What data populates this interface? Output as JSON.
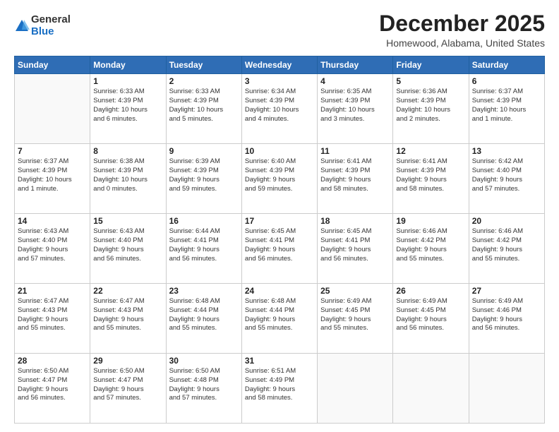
{
  "logo": {
    "general": "General",
    "blue": "Blue"
  },
  "title": "December 2025",
  "location": "Homewood, Alabama, United States",
  "weekdays": [
    "Sunday",
    "Monday",
    "Tuesday",
    "Wednesday",
    "Thursday",
    "Friday",
    "Saturday"
  ],
  "weeks": [
    [
      {
        "day": "",
        "info": ""
      },
      {
        "day": "1",
        "info": "Sunrise: 6:33 AM\nSunset: 4:39 PM\nDaylight: 10 hours\nand 6 minutes."
      },
      {
        "day": "2",
        "info": "Sunrise: 6:33 AM\nSunset: 4:39 PM\nDaylight: 10 hours\nand 5 minutes."
      },
      {
        "day": "3",
        "info": "Sunrise: 6:34 AM\nSunset: 4:39 PM\nDaylight: 10 hours\nand 4 minutes."
      },
      {
        "day": "4",
        "info": "Sunrise: 6:35 AM\nSunset: 4:39 PM\nDaylight: 10 hours\nand 3 minutes."
      },
      {
        "day": "5",
        "info": "Sunrise: 6:36 AM\nSunset: 4:39 PM\nDaylight: 10 hours\nand 2 minutes."
      },
      {
        "day": "6",
        "info": "Sunrise: 6:37 AM\nSunset: 4:39 PM\nDaylight: 10 hours\nand 1 minute."
      }
    ],
    [
      {
        "day": "7",
        "info": "Sunrise: 6:37 AM\nSunset: 4:39 PM\nDaylight: 10 hours\nand 1 minute."
      },
      {
        "day": "8",
        "info": "Sunrise: 6:38 AM\nSunset: 4:39 PM\nDaylight: 10 hours\nand 0 minutes."
      },
      {
        "day": "9",
        "info": "Sunrise: 6:39 AM\nSunset: 4:39 PM\nDaylight: 9 hours\nand 59 minutes."
      },
      {
        "day": "10",
        "info": "Sunrise: 6:40 AM\nSunset: 4:39 PM\nDaylight: 9 hours\nand 59 minutes."
      },
      {
        "day": "11",
        "info": "Sunrise: 6:41 AM\nSunset: 4:39 PM\nDaylight: 9 hours\nand 58 minutes."
      },
      {
        "day": "12",
        "info": "Sunrise: 6:41 AM\nSunset: 4:39 PM\nDaylight: 9 hours\nand 58 minutes."
      },
      {
        "day": "13",
        "info": "Sunrise: 6:42 AM\nSunset: 4:40 PM\nDaylight: 9 hours\nand 57 minutes."
      }
    ],
    [
      {
        "day": "14",
        "info": "Sunrise: 6:43 AM\nSunset: 4:40 PM\nDaylight: 9 hours\nand 57 minutes."
      },
      {
        "day": "15",
        "info": "Sunrise: 6:43 AM\nSunset: 4:40 PM\nDaylight: 9 hours\nand 56 minutes."
      },
      {
        "day": "16",
        "info": "Sunrise: 6:44 AM\nSunset: 4:41 PM\nDaylight: 9 hours\nand 56 minutes."
      },
      {
        "day": "17",
        "info": "Sunrise: 6:45 AM\nSunset: 4:41 PM\nDaylight: 9 hours\nand 56 minutes."
      },
      {
        "day": "18",
        "info": "Sunrise: 6:45 AM\nSunset: 4:41 PM\nDaylight: 9 hours\nand 56 minutes."
      },
      {
        "day": "19",
        "info": "Sunrise: 6:46 AM\nSunset: 4:42 PM\nDaylight: 9 hours\nand 55 minutes."
      },
      {
        "day": "20",
        "info": "Sunrise: 6:46 AM\nSunset: 4:42 PM\nDaylight: 9 hours\nand 55 minutes."
      }
    ],
    [
      {
        "day": "21",
        "info": "Sunrise: 6:47 AM\nSunset: 4:43 PM\nDaylight: 9 hours\nand 55 minutes."
      },
      {
        "day": "22",
        "info": "Sunrise: 6:47 AM\nSunset: 4:43 PM\nDaylight: 9 hours\nand 55 minutes."
      },
      {
        "day": "23",
        "info": "Sunrise: 6:48 AM\nSunset: 4:44 PM\nDaylight: 9 hours\nand 55 minutes."
      },
      {
        "day": "24",
        "info": "Sunrise: 6:48 AM\nSunset: 4:44 PM\nDaylight: 9 hours\nand 55 minutes."
      },
      {
        "day": "25",
        "info": "Sunrise: 6:49 AM\nSunset: 4:45 PM\nDaylight: 9 hours\nand 55 minutes."
      },
      {
        "day": "26",
        "info": "Sunrise: 6:49 AM\nSunset: 4:45 PM\nDaylight: 9 hours\nand 56 minutes."
      },
      {
        "day": "27",
        "info": "Sunrise: 6:49 AM\nSunset: 4:46 PM\nDaylight: 9 hours\nand 56 minutes."
      }
    ],
    [
      {
        "day": "28",
        "info": "Sunrise: 6:50 AM\nSunset: 4:47 PM\nDaylight: 9 hours\nand 56 minutes."
      },
      {
        "day": "29",
        "info": "Sunrise: 6:50 AM\nSunset: 4:47 PM\nDaylight: 9 hours\nand 57 minutes."
      },
      {
        "day": "30",
        "info": "Sunrise: 6:50 AM\nSunset: 4:48 PM\nDaylight: 9 hours\nand 57 minutes."
      },
      {
        "day": "31",
        "info": "Sunrise: 6:51 AM\nSunset: 4:49 PM\nDaylight: 9 hours\nand 58 minutes."
      },
      {
        "day": "",
        "info": ""
      },
      {
        "day": "",
        "info": ""
      },
      {
        "day": "",
        "info": ""
      }
    ]
  ]
}
